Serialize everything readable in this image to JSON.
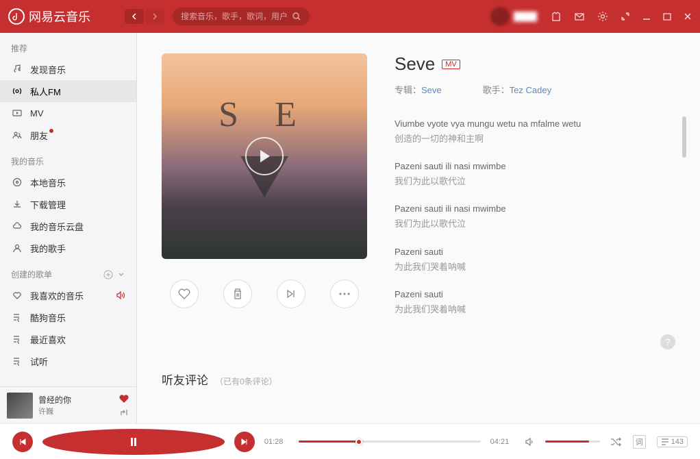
{
  "header": {
    "app_name": "网易云音乐",
    "search_placeholder": "搜索音乐，歌手，歌词，用户"
  },
  "sidebar": {
    "sections": {
      "recommend": {
        "title": "推荐"
      },
      "my_music": {
        "title": "我的音乐"
      },
      "created": {
        "title": "创建的歌单"
      }
    },
    "items": {
      "discover": "发现音乐",
      "fm": "私人FM",
      "mv": "MV",
      "friends": "朋友",
      "local": "本地音乐",
      "download": "下载管理",
      "cloud": "我的音乐云盘",
      "artists": "我的歌手",
      "liked": "我喜欢的音乐",
      "kugou": "酷狗音乐",
      "recent": "最近喜欢",
      "trial": "试听"
    }
  },
  "now_playing": {
    "title": "曾经的你",
    "artist": "许巍"
  },
  "song": {
    "title": "Seve",
    "mv_badge": "MV",
    "album_label": "专辑：",
    "album_name": "Seve",
    "artist_label": "歌手：",
    "artist_name": "Tez Cadey"
  },
  "lyrics": [
    {
      "line": "Viumbe vyote vya mungu wetu na mfalme wetu",
      "trans": "创造的一切的神和主啊"
    },
    {
      "line": "Pazeni sauti ili nasi mwimbe",
      "trans": "我们为此以歌代泣"
    },
    {
      "line": "Pazeni sauti ili nasi mwimbe",
      "trans": "我们为此以歌代泣"
    },
    {
      "line": "Pazeni sauti",
      "trans": "为此我们哭着呐喊"
    },
    {
      "line": "Pazeni sauti",
      "trans": "为此我们哭着呐喊"
    }
  ],
  "comments": {
    "title": "听友评论",
    "count_text": "（已有0条评论）"
  },
  "player": {
    "current_time": "01:28",
    "total_time": "04:21",
    "progress_pct": 33,
    "playlist_count": "143"
  }
}
